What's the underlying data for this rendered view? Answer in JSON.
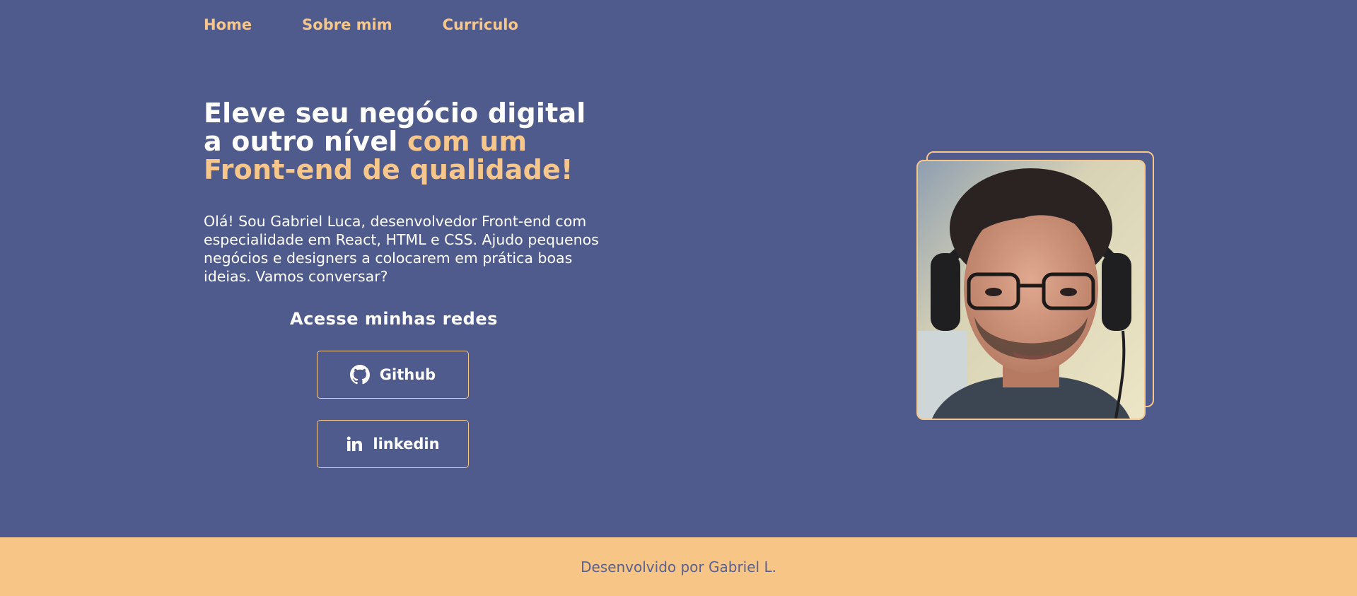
{
  "nav": {
    "items": [
      {
        "label": "Home"
      },
      {
        "label": "Sobre mim"
      },
      {
        "label": "Curriculo"
      }
    ]
  },
  "hero": {
    "title_part1": "Eleve seu negócio digital a outro nível ",
    "title_accent": "com um Front-end de qualidade!",
    "intro": "Olá! Sou Gabriel Luca, desenvolvedor Front-end com especialidade em React, HTML e CSS. Ajudo pequenos negócios e designers a colocarem em prática boas ideias. Vamos conversar?"
  },
  "social": {
    "heading": "Acesse minhas redes",
    "github_label": "Github",
    "linkedin_label": "linkedin"
  },
  "footer": {
    "text": "Desenvolvido por Gabriel L."
  },
  "colors": {
    "background": "#4f5b8c",
    "accent": "#f7c68a",
    "footer_bg": "#f7c686",
    "footer_text": "#5a6190"
  },
  "icons": [
    "github-icon",
    "linkedin-icon"
  ]
}
